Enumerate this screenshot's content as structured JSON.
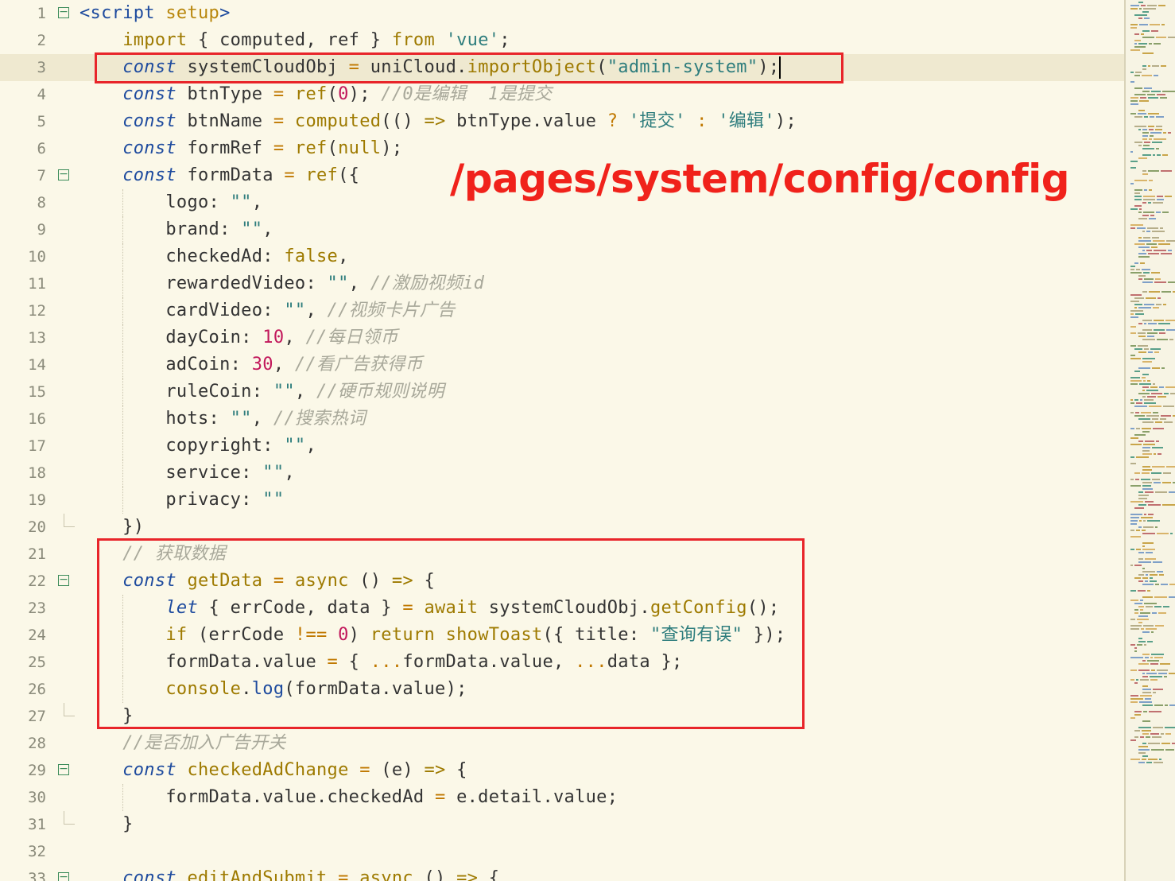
{
  "annotation_text": "/pages/system/config/config",
  "current_line": 3,
  "colors": {
    "highlight_box": "#e8252a",
    "annotation": "#f0221b",
    "background": "#fbf8e8"
  },
  "lines": [
    {
      "n": "1",
      "fold": "open",
      "guides": [],
      "segs": [
        [
          "tag",
          "<script"
        ],
        [
          "p",
          " "
        ],
        [
          "attr",
          "setup"
        ],
        [
          "tag",
          ">"
        ]
      ]
    },
    {
      "n": "2",
      "guides": [],
      "segs": [
        [
          "p",
          "    "
        ],
        [
          "kw2",
          "import"
        ],
        [
          "p",
          " { computed, ref } "
        ],
        [
          "kw2",
          "from"
        ],
        [
          "p",
          " "
        ],
        [
          "str",
          "'vue'"
        ],
        [
          "p",
          ";"
        ]
      ]
    },
    {
      "n": "3",
      "guides": [],
      "segs": [
        [
          "p",
          "    "
        ],
        [
          "kw",
          "const"
        ],
        [
          "p",
          " systemCloudObj "
        ],
        [
          "op",
          "="
        ],
        [
          "p",
          " uniCloud."
        ],
        [
          "fn",
          "importObject"
        ],
        [
          "p",
          "("
        ],
        [
          "str",
          "\"admin-system\""
        ],
        [
          "p",
          ");"
        ],
        [
          "caret",
          ""
        ]
      ]
    },
    {
      "n": "4",
      "guides": [],
      "segs": [
        [
          "p",
          "    "
        ],
        [
          "kw",
          "const"
        ],
        [
          "p",
          " btnType "
        ],
        [
          "op",
          "="
        ],
        [
          "p",
          " "
        ],
        [
          "fn",
          "ref"
        ],
        [
          "p",
          "("
        ],
        [
          "num",
          "0"
        ],
        [
          "p",
          "); "
        ],
        [
          "cm",
          "//0是编辑  1是提交"
        ]
      ]
    },
    {
      "n": "5",
      "guides": [],
      "segs": [
        [
          "p",
          "    "
        ],
        [
          "kw",
          "const"
        ],
        [
          "p",
          " btnName "
        ],
        [
          "op",
          "="
        ],
        [
          "p",
          " "
        ],
        [
          "fn",
          "computed"
        ],
        [
          "p",
          "(() "
        ],
        [
          "kw2",
          "=>"
        ],
        [
          "p",
          " btnType.value "
        ],
        [
          "op",
          "?"
        ],
        [
          "p",
          " "
        ],
        [
          "str",
          "'提交'"
        ],
        [
          "p",
          " "
        ],
        [
          "op",
          ":"
        ],
        [
          "p",
          " "
        ],
        [
          "str",
          "'编辑'"
        ],
        [
          "p",
          ");"
        ]
      ]
    },
    {
      "n": "6",
      "guides": [],
      "segs": [
        [
          "p",
          "    "
        ],
        [
          "kw",
          "const"
        ],
        [
          "p",
          " formRef "
        ],
        [
          "op",
          "="
        ],
        [
          "p",
          " "
        ],
        [
          "fn",
          "ref"
        ],
        [
          "p",
          "("
        ],
        [
          "kw2",
          "null"
        ],
        [
          "p",
          ");"
        ]
      ]
    },
    {
      "n": "7",
      "fold": "open",
      "guides": [],
      "segs": [
        [
          "p",
          "    "
        ],
        [
          "kw",
          "const"
        ],
        [
          "p",
          " formData "
        ],
        [
          "op",
          "="
        ],
        [
          "p",
          " "
        ],
        [
          "fn",
          "ref"
        ],
        [
          "p",
          "({"
        ]
      ]
    },
    {
      "n": "8",
      "guides": [
        154
      ],
      "segs": [
        [
          "p",
          "        logo: "
        ],
        [
          "str",
          "\"\""
        ],
        [
          "p",
          ","
        ]
      ]
    },
    {
      "n": "9",
      "guides": [
        154
      ],
      "segs": [
        [
          "p",
          "        brand: "
        ],
        [
          "str",
          "\"\""
        ],
        [
          "p",
          ","
        ]
      ]
    },
    {
      "n": "10",
      "guides": [
        154
      ],
      "segs": [
        [
          "p",
          "        checkedAd: "
        ],
        [
          "kw2",
          "false"
        ],
        [
          "p",
          ","
        ]
      ]
    },
    {
      "n": "11",
      "guides": [
        154
      ],
      "segs": [
        [
          "p",
          "        rewardedVideo: "
        ],
        [
          "str",
          "\"\""
        ],
        [
          "p",
          ", "
        ],
        [
          "cm",
          "//激励视频id"
        ]
      ]
    },
    {
      "n": "12",
      "guides": [
        154
      ],
      "segs": [
        [
          "p",
          "        cardVideo: "
        ],
        [
          "str",
          "\"\""
        ],
        [
          "p",
          ", "
        ],
        [
          "cm",
          "//视频卡片广告"
        ]
      ]
    },
    {
      "n": "13",
      "guides": [
        154
      ],
      "segs": [
        [
          "p",
          "        dayCoin: "
        ],
        [
          "num",
          "10"
        ],
        [
          "p",
          ", "
        ],
        [
          "cm",
          "//每日领币"
        ]
      ]
    },
    {
      "n": "14",
      "guides": [
        154
      ],
      "segs": [
        [
          "p",
          "        adCoin: "
        ],
        [
          "num",
          "30"
        ],
        [
          "p",
          ", "
        ],
        [
          "cm",
          "//看广告获得币"
        ]
      ]
    },
    {
      "n": "15",
      "guides": [
        154
      ],
      "segs": [
        [
          "p",
          "        ruleCoin: "
        ],
        [
          "str",
          "\"\""
        ],
        [
          "p",
          ", "
        ],
        [
          "cm",
          "//硬币规则说明"
        ]
      ]
    },
    {
      "n": "16",
      "guides": [
        154
      ],
      "segs": [
        [
          "p",
          "        hots: "
        ],
        [
          "str",
          "\"\""
        ],
        [
          "p",
          ", "
        ],
        [
          "cm",
          "//搜索热词"
        ]
      ]
    },
    {
      "n": "17",
      "guides": [
        154
      ],
      "segs": [
        [
          "p",
          "        copyright: "
        ],
        [
          "str",
          "\"\""
        ],
        [
          "p",
          ","
        ]
      ]
    },
    {
      "n": "18",
      "guides": [
        154
      ],
      "segs": [
        [
          "p",
          "        service: "
        ],
        [
          "str",
          "\"\""
        ],
        [
          "p",
          ","
        ]
      ]
    },
    {
      "n": "19",
      "guides": [
        154
      ],
      "segs": [
        [
          "p",
          "        privacy: "
        ],
        [
          "str",
          "\"\""
        ]
      ]
    },
    {
      "n": "20",
      "fold": "end",
      "guides": [],
      "segs": [
        [
          "p",
          "    })"
        ]
      ]
    },
    {
      "n": "21",
      "guides": [],
      "segs": [
        [
          "p",
          "    "
        ],
        [
          "cm",
          "// 获取数据"
        ]
      ]
    },
    {
      "n": "22",
      "fold": "open",
      "guides": [],
      "segs": [
        [
          "p",
          "    "
        ],
        [
          "kw",
          "const"
        ],
        [
          "p",
          " "
        ],
        [
          "fn",
          "getData"
        ],
        [
          "p",
          " "
        ],
        [
          "op",
          "="
        ],
        [
          "p",
          " "
        ],
        [
          "kw2",
          "async"
        ],
        [
          "p",
          " () "
        ],
        [
          "kw2",
          "=>"
        ],
        [
          "p",
          " {"
        ]
      ]
    },
    {
      "n": "23",
      "guides": [
        154
      ],
      "segs": [
        [
          "p",
          "        "
        ],
        [
          "kw",
          "let"
        ],
        [
          "p",
          " { errCode, data } "
        ],
        [
          "op",
          "="
        ],
        [
          "p",
          " "
        ],
        [
          "kw2",
          "await"
        ],
        [
          "p",
          " systemCloudObj."
        ],
        [
          "fn",
          "getConfig"
        ],
        [
          "p",
          "();"
        ]
      ]
    },
    {
      "n": "24",
      "guides": [
        154
      ],
      "segs": [
        [
          "p",
          "        "
        ],
        [
          "kw2",
          "if"
        ],
        [
          "p",
          " (errCode "
        ],
        [
          "op",
          "!=="
        ],
        [
          "p",
          " "
        ],
        [
          "num",
          "0"
        ],
        [
          "p",
          ") "
        ],
        [
          "kw2",
          "return"
        ],
        [
          "p",
          " "
        ],
        [
          "fn",
          "showToast"
        ],
        [
          "p",
          "({ title: "
        ],
        [
          "str",
          "\"查询有误\""
        ],
        [
          "p",
          " });"
        ]
      ]
    },
    {
      "n": "25",
      "guides": [
        154
      ],
      "segs": [
        [
          "p",
          "        formData.value "
        ],
        [
          "op",
          "="
        ],
        [
          "p",
          " { "
        ],
        [
          "op",
          "..."
        ],
        [
          "p",
          "formData.value, "
        ],
        [
          "op",
          "..."
        ],
        [
          "p",
          "data };"
        ]
      ]
    },
    {
      "n": "26",
      "guides": [
        154
      ],
      "segs": [
        [
          "p",
          "        "
        ],
        [
          "kw2",
          "console"
        ],
        [
          "p",
          "."
        ],
        [
          "tag",
          "log"
        ],
        [
          "p",
          "(formData.value);"
        ]
      ]
    },
    {
      "n": "27",
      "fold": "end",
      "guides": [],
      "segs": [
        [
          "p",
          "    }"
        ]
      ]
    },
    {
      "n": "28",
      "guides": [],
      "segs": [
        [
          "p",
          "    "
        ],
        [
          "cm",
          "//是否加入广告开关"
        ]
      ]
    },
    {
      "n": "29",
      "fold": "open",
      "guides": [],
      "segs": [
        [
          "p",
          "    "
        ],
        [
          "kw",
          "const"
        ],
        [
          "p",
          " "
        ],
        [
          "fn",
          "checkedAdChange"
        ],
        [
          "p",
          " "
        ],
        [
          "op",
          "="
        ],
        [
          "p",
          " (e) "
        ],
        [
          "kw2",
          "=>"
        ],
        [
          "p",
          " {"
        ]
      ]
    },
    {
      "n": "30",
      "guides": [
        154
      ],
      "segs": [
        [
          "p",
          "        formData.value.checkedAd "
        ],
        [
          "op",
          "="
        ],
        [
          "p",
          " e.detail.value;"
        ]
      ]
    },
    {
      "n": "31",
      "fold": "end",
      "guides": [],
      "segs": [
        [
          "p",
          "    }"
        ]
      ]
    },
    {
      "n": "32",
      "guides": [],
      "segs": []
    },
    {
      "n": "33",
      "fold": "open",
      "guides": [],
      "segs": [
        [
          "p",
          "    "
        ],
        [
          "kw",
          "const"
        ],
        [
          "p",
          " "
        ],
        [
          "fn",
          "editAndSubmit"
        ],
        [
          "p",
          " "
        ],
        [
          "op",
          "="
        ],
        [
          "p",
          " "
        ],
        [
          "kw2",
          "async"
        ],
        [
          "p",
          " () "
        ],
        [
          "kw2",
          "=>"
        ],
        [
          "p",
          " {"
        ]
      ]
    }
  ]
}
